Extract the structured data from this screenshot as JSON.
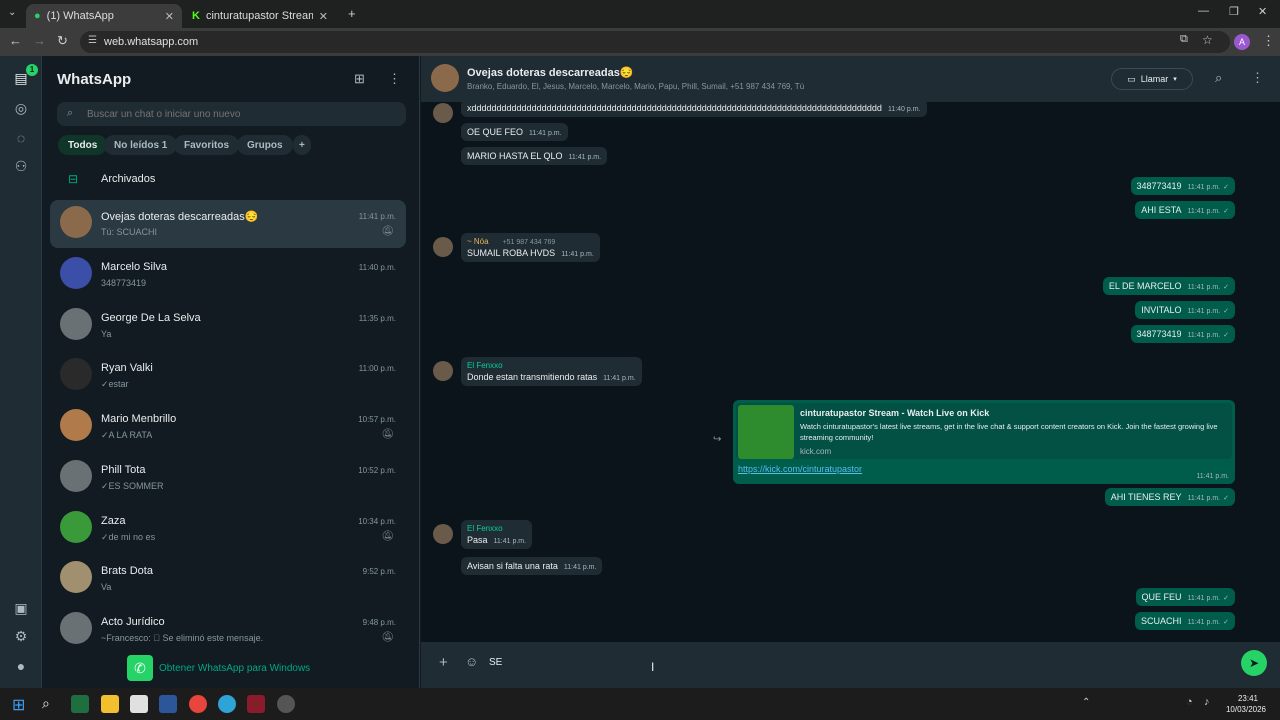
{
  "browser": {
    "tabs": [
      {
        "label": "(1) WhatsApp",
        "active": true
      },
      {
        "label": "cinturatupastor Stream - Watch",
        "active": false
      }
    ],
    "url": "web.whatsapp.com"
  },
  "sidebar": {
    "title": "WhatsApp",
    "search_placeholder": "Buscar un chat o iniciar uno nuevo",
    "filters": [
      "Todos",
      "No leídos 1",
      "Favoritos",
      "Grupos"
    ],
    "archived": "Archivados",
    "rail_badge": "1",
    "chats": [
      {
        "name": "Ovejas doteras descarreadas😔",
        "preview": "Tú: SCUACHI",
        "time": "11:41 p.m.",
        "muted": true
      },
      {
        "name": "Marcelo Silva",
        "preview": "348773419",
        "time": "11:40 p.m.",
        "muted": false
      },
      {
        "name": "George De La Selva",
        "preview": "Ya",
        "time": "11:35 p.m.",
        "muted": false
      },
      {
        "name": "Ryan Valki",
        "preview": "✓estar",
        "time": "11:00 p.m.",
        "muted": false
      },
      {
        "name": "Mario Menbrillo",
        "preview": "✓A LA RATA",
        "time": "10:57 p.m.",
        "muted": true
      },
      {
        "name": "Phill Tota",
        "preview": "✓ES SOMMER",
        "time": "10:52 p.m.",
        "muted": false
      },
      {
        "name": "Zaza",
        "preview": "✓de mi no es",
        "time": "10:34 p.m.",
        "muted": true
      },
      {
        "name": "Brats Dota",
        "preview": "Va",
        "time": "9:52 p.m.",
        "muted": false
      },
      {
        "name": "Acto Jurídico",
        "preview": "~Francesco: ⃠ Se eliminó este mensaje.",
        "time": "9:48 p.m.",
        "muted": true
      }
    ],
    "get_app": "Obtener WhatsApp para Windows"
  },
  "chat": {
    "title": "Ovejas doteras descarreadas😔",
    "members": "Branko, Eduardo, El, Jesus, Marcelo, Marcelo, Mario, Papu, Phill, Sumail, +51 987 434 769, Tú",
    "call_label": "Llamar",
    "messages": [
      {
        "text": "xdddddddddddddddddddddddddddddddddddddddddddddddddddddddddddddddddddddddddddddddddd",
        "time": "11:40 p.m.",
        "dir": "in"
      },
      {
        "text": "OE QUE FEO",
        "time": "11:41 p.m.",
        "dir": "in"
      },
      {
        "text": "MARIO HASTA EL QLO",
        "time": "11:41 p.m.",
        "dir": "in"
      },
      {
        "text": "348773419",
        "time": "11:41 p.m.",
        "dir": "out"
      },
      {
        "text": "AHI ESTA",
        "time": "11:41 p.m.",
        "dir": "out"
      },
      {
        "sender": "~ Nóa",
        "phone": "+51 987 434 769",
        "text": "SUMAIL ROBA HVDS",
        "time": "11:41 p.m.",
        "dir": "in"
      },
      {
        "text": "EL DE MARCELO",
        "time": "11:41 p.m.",
        "dir": "out"
      },
      {
        "text": "INVITALO",
        "time": "11:41 p.m.",
        "dir": "out"
      },
      {
        "text": "348773419",
        "time": "11:41 p.m.",
        "dir": "out"
      },
      {
        "sender": "El Fenxxo",
        "text": "Donde estan transmitiendo ratas",
        "time": "11:41 p.m.",
        "dir": "in"
      },
      {
        "text": "AHI TIENES REY",
        "time": "11:41 p.m.",
        "dir": "out"
      },
      {
        "sender": "El Fenxxo",
        "text": "Pasa",
        "time": "11:41 p.m.",
        "dir": "in"
      },
      {
        "text": "Avisan si falta una rata",
        "time": "11:41 p.m.",
        "dir": "in"
      },
      {
        "text": "QUE FEU",
        "time": "11:41 p.m.",
        "dir": "out"
      },
      {
        "text": "SCUACHI",
        "time": "11:41 p.m.",
        "dir": "out"
      }
    ],
    "link_preview": {
      "title": "cinturatupastor Stream - Watch Live on Kick",
      "desc": "Watch cinturatupastor's latest live streams, get in the live chat & support content creators on Kick. Join the fastest growing live streaming community!",
      "domain": "kick.com",
      "url": "https://kick.com/cinturatupastor",
      "time": "11:41 p.m."
    },
    "composer_value": "SE"
  },
  "taskbar": {
    "time": "23:41",
    "date": "10/03/2026"
  },
  "colors": {
    "accent": "#00a884",
    "outgoing": "#005c4b",
    "incoming": "#202c33"
  }
}
